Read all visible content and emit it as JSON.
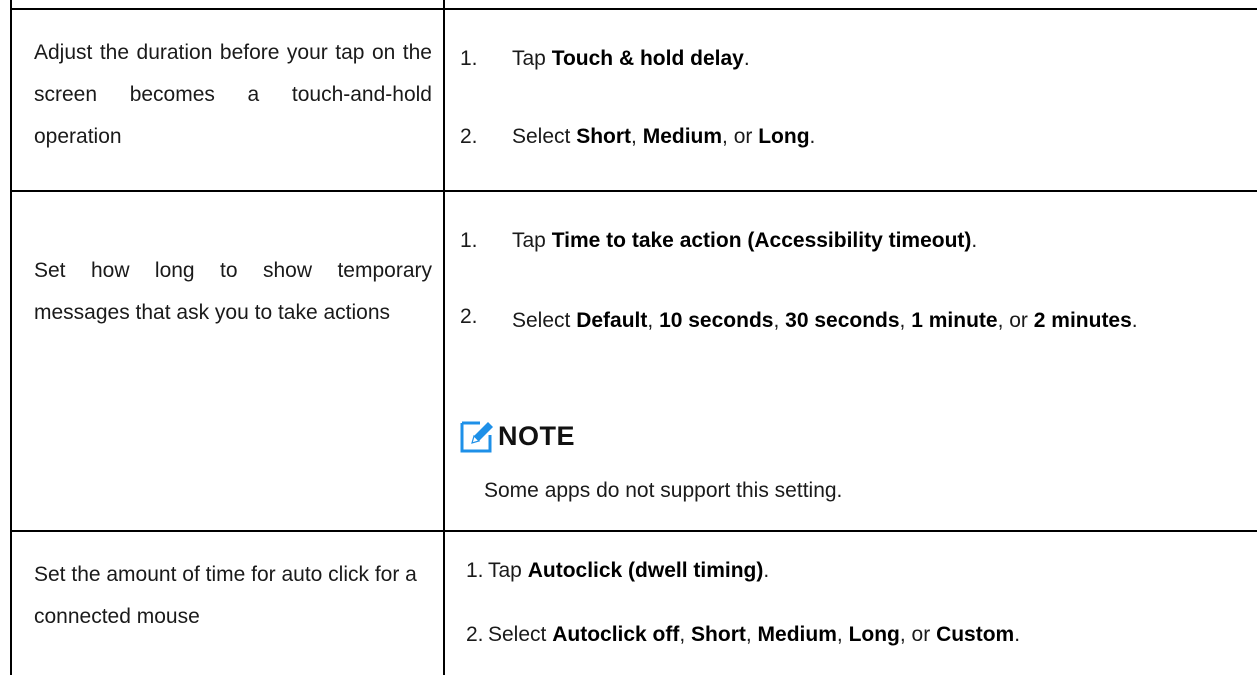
{
  "rows": [
    {
      "description": "Adjust the duration before your tap on the screen becomes a touch-and-hold operation",
      "steps": [
        {
          "num": "1.",
          "prefix": "Tap ",
          "parts": [
            {
              "text": "Touch & hold delay",
              "bold": true
            },
            {
              "text": ".",
              "bold": false
            }
          ]
        },
        {
          "num": "2.",
          "prefix": "Select ",
          "parts": [
            {
              "text": "Short",
              "bold": true
            },
            {
              "text": ", ",
              "bold": false
            },
            {
              "text": "Medium",
              "bold": true
            },
            {
              "text": ", or ",
              "bold": false
            },
            {
              "text": "Long",
              "bold": true
            },
            {
              "text": ".",
              "bold": false
            }
          ]
        }
      ]
    },
    {
      "description": "Set how long to show temporary messages that ask you to take actions",
      "steps": [
        {
          "num": "1.",
          "prefix": "Tap ",
          "parts": [
            {
              "text": "Time to take action (Accessibility timeout)",
              "bold": true
            },
            {
              "text": ".",
              "bold": false
            }
          ]
        },
        {
          "num": "2.",
          "prefix": "Select ",
          "parts": [
            {
              "text": "Default",
              "bold": true
            },
            {
              "text": ", ",
              "bold": false
            },
            {
              "text": "10 seconds",
              "bold": true
            },
            {
              "text": ", ",
              "bold": false
            },
            {
              "text": "30 seconds",
              "bold": true
            },
            {
              "text": ", ",
              "bold": false
            },
            {
              "text": "1 minute",
              "bold": true
            },
            {
              "text": ", or ",
              "bold": false
            },
            {
              "text": "2 minutes",
              "bold": true
            },
            {
              "text": ".",
              "bold": false
            }
          ]
        }
      ],
      "note": {
        "label": "NOTE",
        "icon": "note-pencil-icon",
        "text": "Some apps do not support this setting."
      }
    },
    {
      "description": "Set the amount of time for auto click for a connected mouse",
      "steps": [
        {
          "num": "1.",
          "prefix": "Tap ",
          "parts": [
            {
              "text": "Autoclick (dwell timing)",
              "bold": true
            },
            {
              "text": ".",
              "bold": false
            }
          ]
        },
        {
          "num": "2.",
          "prefix": "Select ",
          "parts": [
            {
              "text": "Autoclick off",
              "bold": true
            },
            {
              "text": ", ",
              "bold": false
            },
            {
              "text": "Short",
              "bold": true
            },
            {
              "text": ", ",
              "bold": false
            },
            {
              "text": "Medium",
              "bold": true
            },
            {
              "text": ", ",
              "bold": false
            },
            {
              "text": "Long",
              "bold": true
            },
            {
              "text": ", or ",
              "bold": false
            },
            {
              "text": "Custom",
              "bold": true
            },
            {
              "text": ".",
              "bold": false
            }
          ]
        }
      ]
    }
  ],
  "colors": {
    "note_icon": "#1e90e8",
    "border": "#000000",
    "text": "#1a1a1a"
  }
}
